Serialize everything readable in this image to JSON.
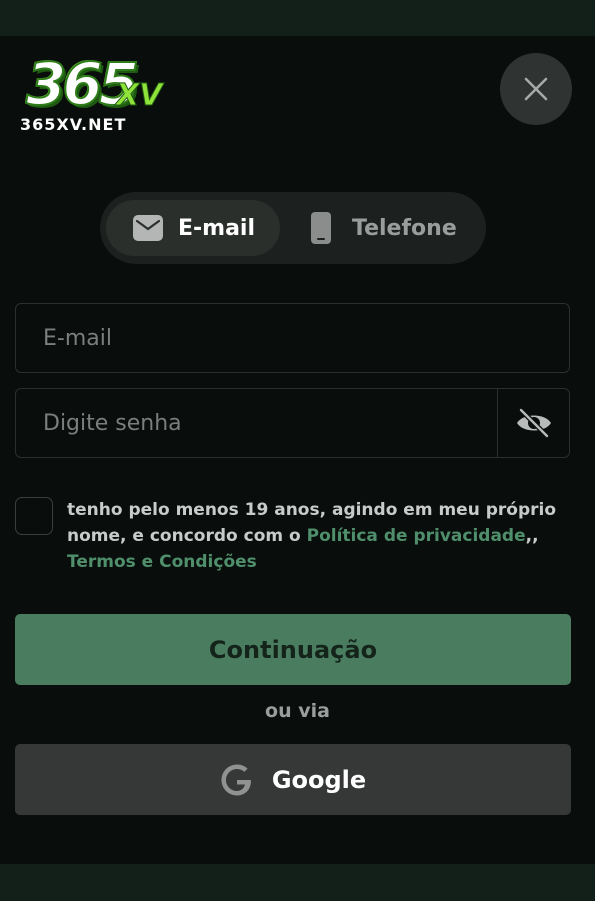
{
  "brand": {
    "logo_number": "365",
    "logo_suffix": "XV",
    "logo_url": "365XV.NET"
  },
  "modal": {
    "close_icon": "close-icon"
  },
  "tabs": [
    {
      "label": "E-mail",
      "icon": "mail-icon",
      "active": true
    },
    {
      "label": "Telefone",
      "icon": "phone-icon",
      "active": false
    }
  ],
  "form": {
    "email_placeholder": "E-mail",
    "email_value": "",
    "password_placeholder": "Digite senha",
    "password_value": "",
    "password_toggle_icon": "eye-off-icon",
    "agree_checked": false,
    "terms_text": "tenho pelo menos 19 anos, agindo em meu próprio nome, e concordo com o ",
    "privacy_link": "Política de privacidade",
    "separator": ",, ",
    "terms_link": "Termos e Condições",
    "submit_label": "Continuação",
    "or_label": "ou via",
    "google_label": "Google"
  },
  "colors": {
    "accent": "#4a7d5f",
    "link": "#4f8f6c",
    "background": "#090d0b",
    "brand_green": "#8ee23a"
  }
}
